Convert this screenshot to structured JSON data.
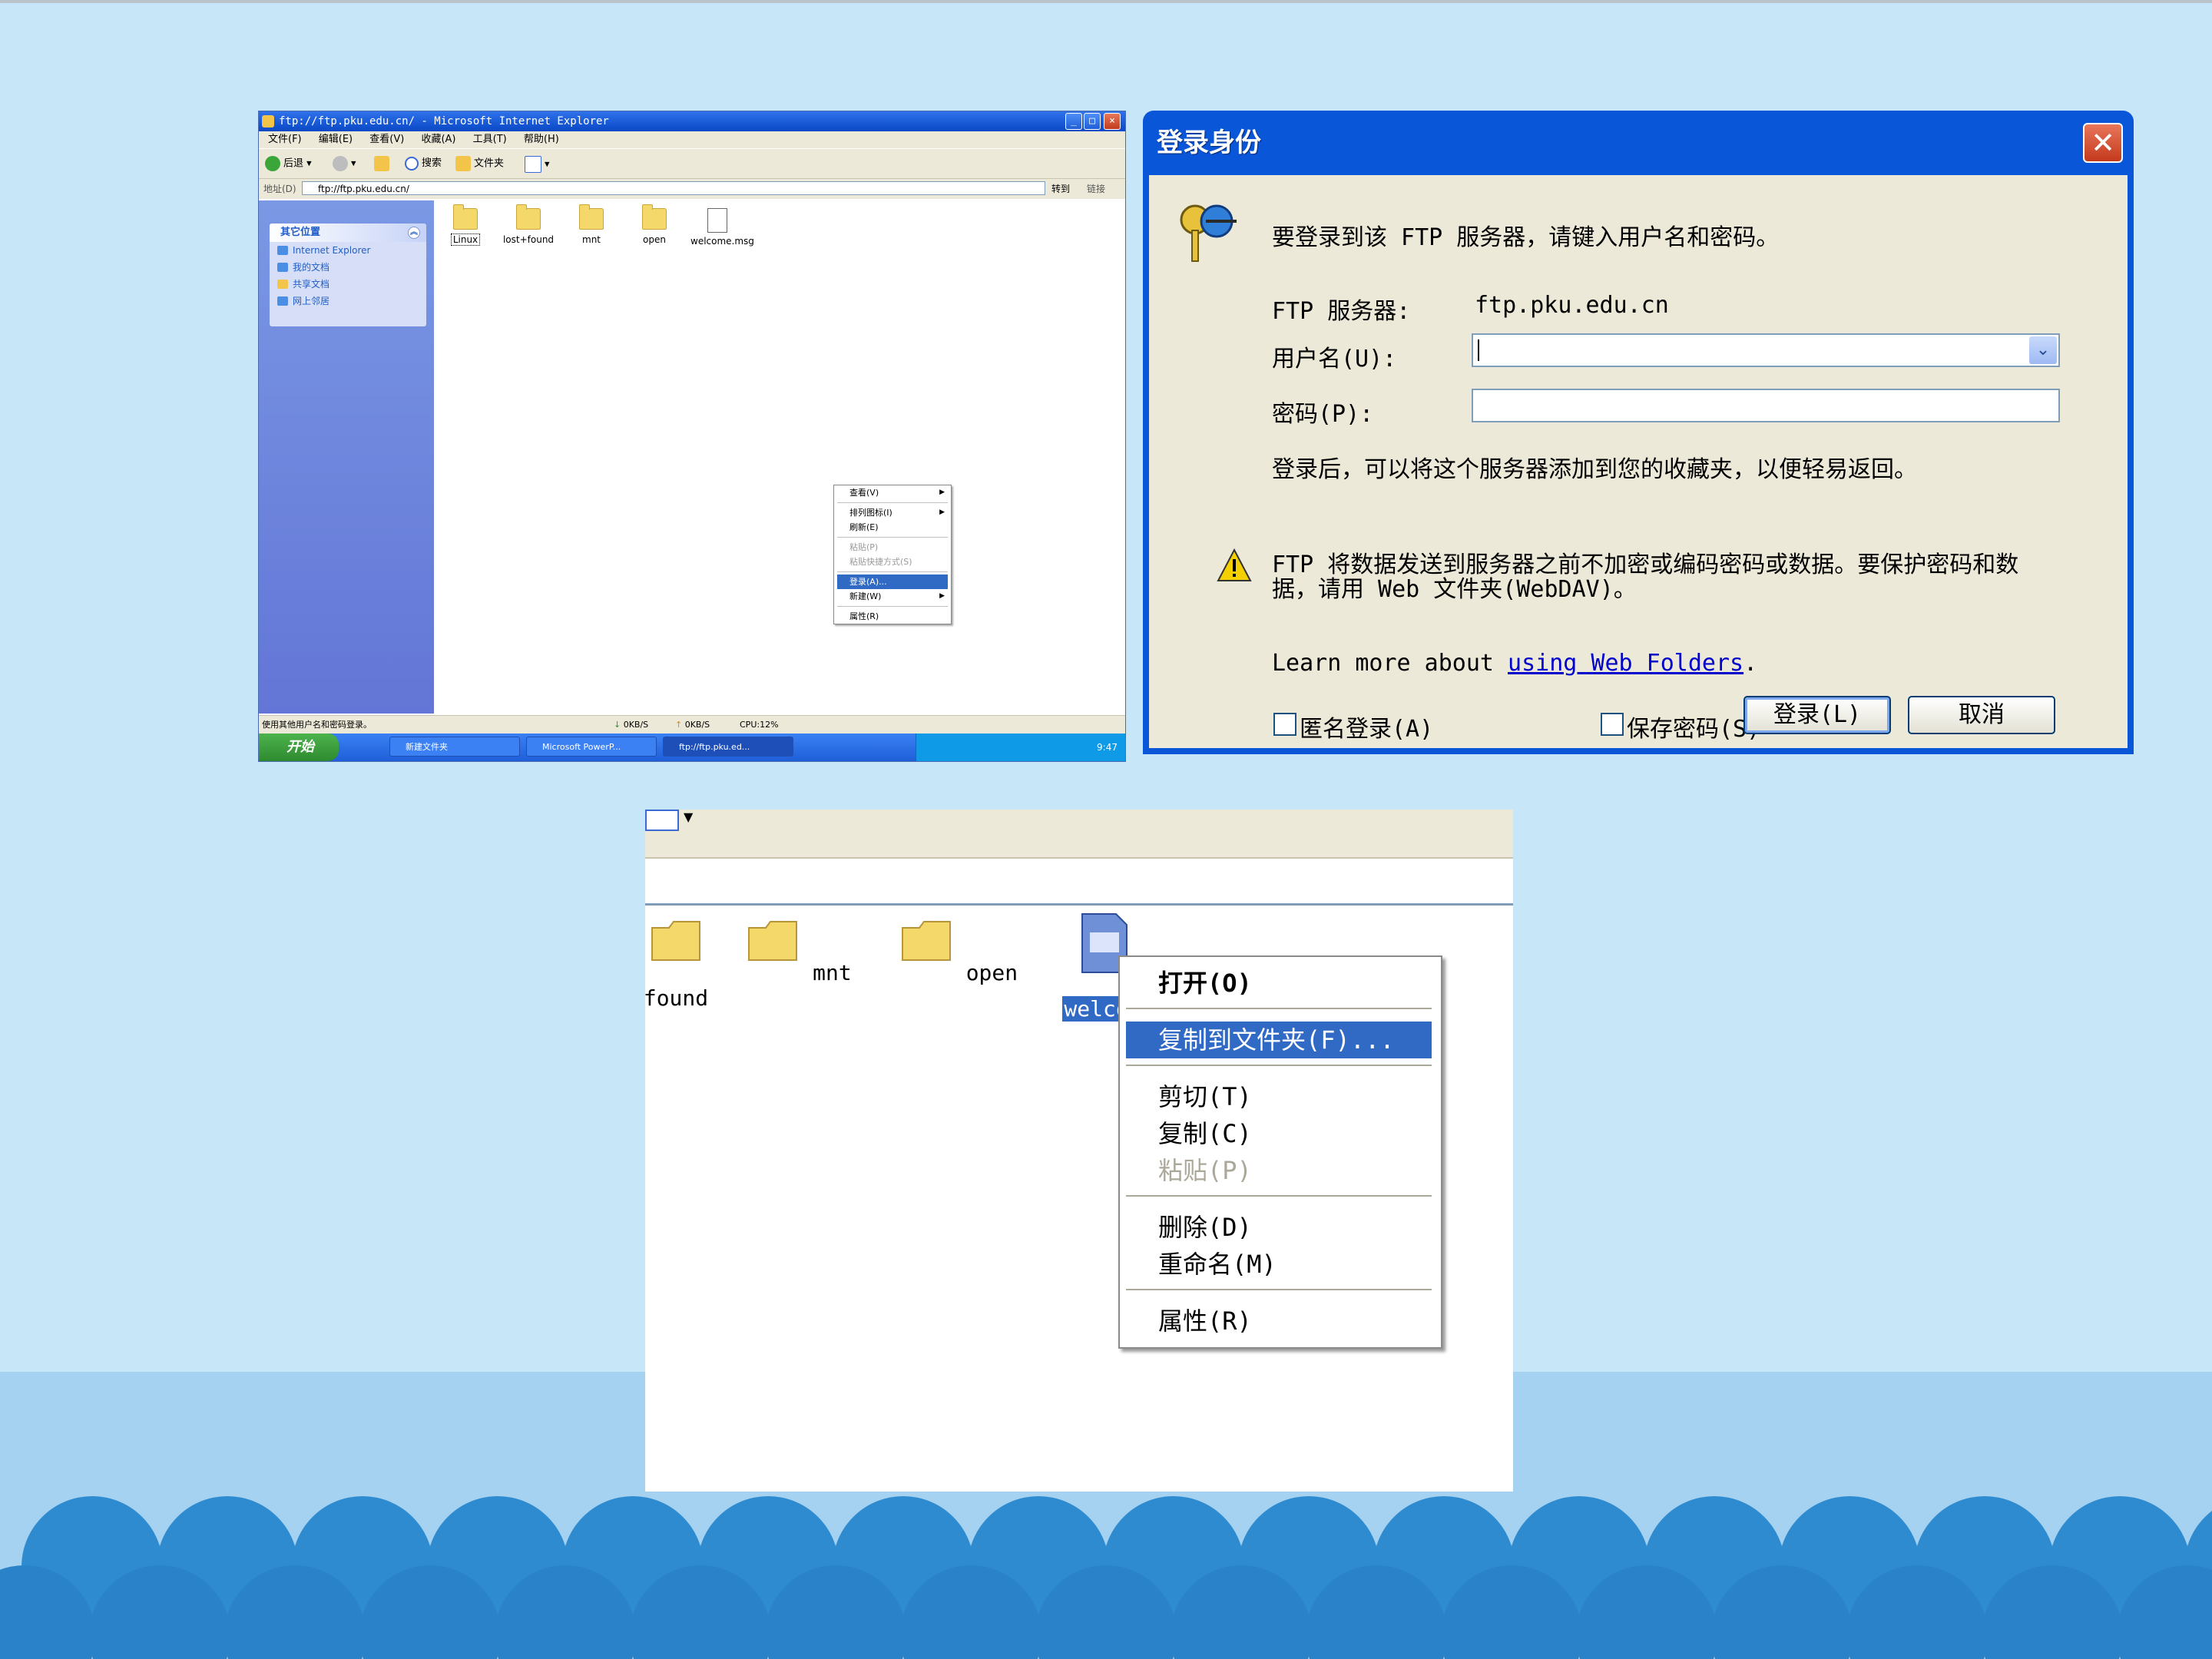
{
  "ie_window": {
    "title": "ftp://ftp.pku.edu.cn/ - Microsoft Internet Explorer",
    "menu": [
      "文件(F)",
      "编辑(E)",
      "查看(V)",
      "收藏(A)",
      "工具(T)",
      "帮助(H)"
    ],
    "toolbar": {
      "back": "后退",
      "search": "搜索",
      "folders": "文件夹"
    },
    "address": {
      "label": "地址(D)",
      "value": "ftp://ftp.pku.edu.cn/",
      "go": "转到",
      "links": "链接"
    },
    "sidebar": {
      "title": "其它位置",
      "items": [
        "Internet Explorer",
        "我的文档",
        "共享文档",
        "网上邻居"
      ]
    },
    "files": [
      "Linux",
      "lost+found",
      "mnt",
      "open",
      "welcome.msg"
    ],
    "context_menu": [
      {
        "label": "查看(V)",
        "submenu": true
      },
      {
        "label": "排列图标(I)",
        "submenu": true
      },
      {
        "label": "刷新(E)"
      },
      {
        "label": "粘贴(P)",
        "disabled": true
      },
      {
        "label": "粘贴快捷方式(S)",
        "disabled": true
      },
      {
        "label": "登录(A)...",
        "selected": true
      },
      {
        "label": "新建(W)",
        "submenu": true
      },
      {
        "label": "属性(R)"
      }
    ],
    "status": {
      "text": "使用其他用户名和密码登录。",
      "down": "0KB/S",
      "up": "0KB/S",
      "cpu": "CPU:12%"
    },
    "taskbar": {
      "start": "开始",
      "items": [
        "新建文件夹",
        "Microsoft PowerP...",
        "ftp://ftp.pku.ed..."
      ],
      "clock": "9:47"
    }
  },
  "login_dialog": {
    "title": "登录身份",
    "prompt": "要登录到该 FTP 服务器，请键入用户名和密码。",
    "server_label": "FTP 服务器:",
    "server_value": "ftp.pku.edu.cn",
    "username_label": "用户名(U):",
    "username_value": "",
    "password_label": "密码(P):",
    "password_value": "",
    "info": "登录后，可以将这个服务器添加到您的收藏夹，以便轻易返回。",
    "warning_line1": "FTP 将数据发送到服务器之前不加密或编码密码或数据。要保护密码和数",
    "warning_line2": "据，请用 Web 文件夹(WebDAV)。",
    "learn_prefix": "Learn more about ",
    "learn_link": "using Web Folders",
    "learn_suffix": ".",
    "anonymous_label": "匿名登录(A)",
    "save_password_label": "保存密码(S)",
    "login_button": "登录(L)",
    "cancel_button": "取消"
  },
  "zoomed_explorer": {
    "files": [
      "found",
      "mnt",
      "open",
      "welcom"
    ],
    "context_menu": {
      "open": "打开(O)",
      "copy_to_folder": "复制到文件夹(F)...",
      "cut": "剪切(T)",
      "copy": "复制(C)",
      "paste": "粘贴(P)",
      "delete": "删除(D)",
      "rename": "重命名(M)",
      "properties": "属性(R)"
    }
  }
}
